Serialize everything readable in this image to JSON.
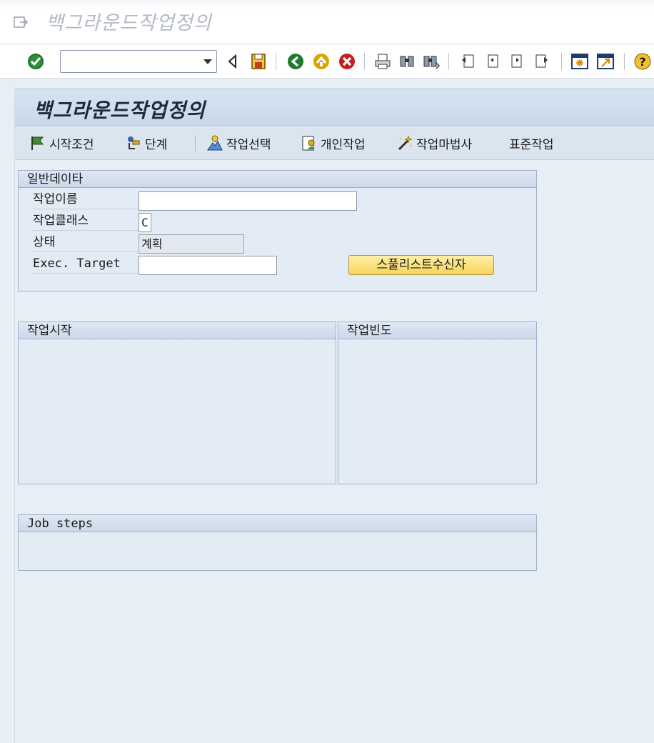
{
  "window": {
    "title": "백그라운드작업정의"
  },
  "toolbar": {
    "icons": [
      "enter-check-icon",
      "save-icon",
      "back-icon",
      "exit-icon",
      "cancel-icon",
      "print-icon",
      "find-icon",
      "find-next-icon",
      "first-page-icon",
      "prev-page-icon",
      "next-page-icon",
      "last-page-icon",
      "new-session-icon",
      "shortcut-icon",
      "help-icon"
    ]
  },
  "page": {
    "title": "백그라운드작업정의"
  },
  "app_toolbar": {
    "start_condition": "시작조건",
    "steps": "단계",
    "job_selection": "작업선택",
    "own_jobs": "개인작업",
    "job_wizard": "작업마법사",
    "standard_jobs": "표준작업"
  },
  "general": {
    "title": "일반데이타",
    "job_name_label": "작업이름",
    "job_name_value": "",
    "job_class_label": "작업클래스",
    "job_class_value": "C",
    "status_label": "상태",
    "status_value": "계획",
    "exec_target_label": "Exec. Target",
    "exec_target_value": "",
    "spool_button": "스풀리스트수신자"
  },
  "job_start": {
    "title": "작업시작"
  },
  "job_frequency": {
    "title": "작업빈도"
  },
  "job_steps": {
    "title": "Job steps"
  },
  "colors": {
    "accent": "#c9d8ea",
    "button": "#f6d35a",
    "background": "#e8eef6"
  }
}
